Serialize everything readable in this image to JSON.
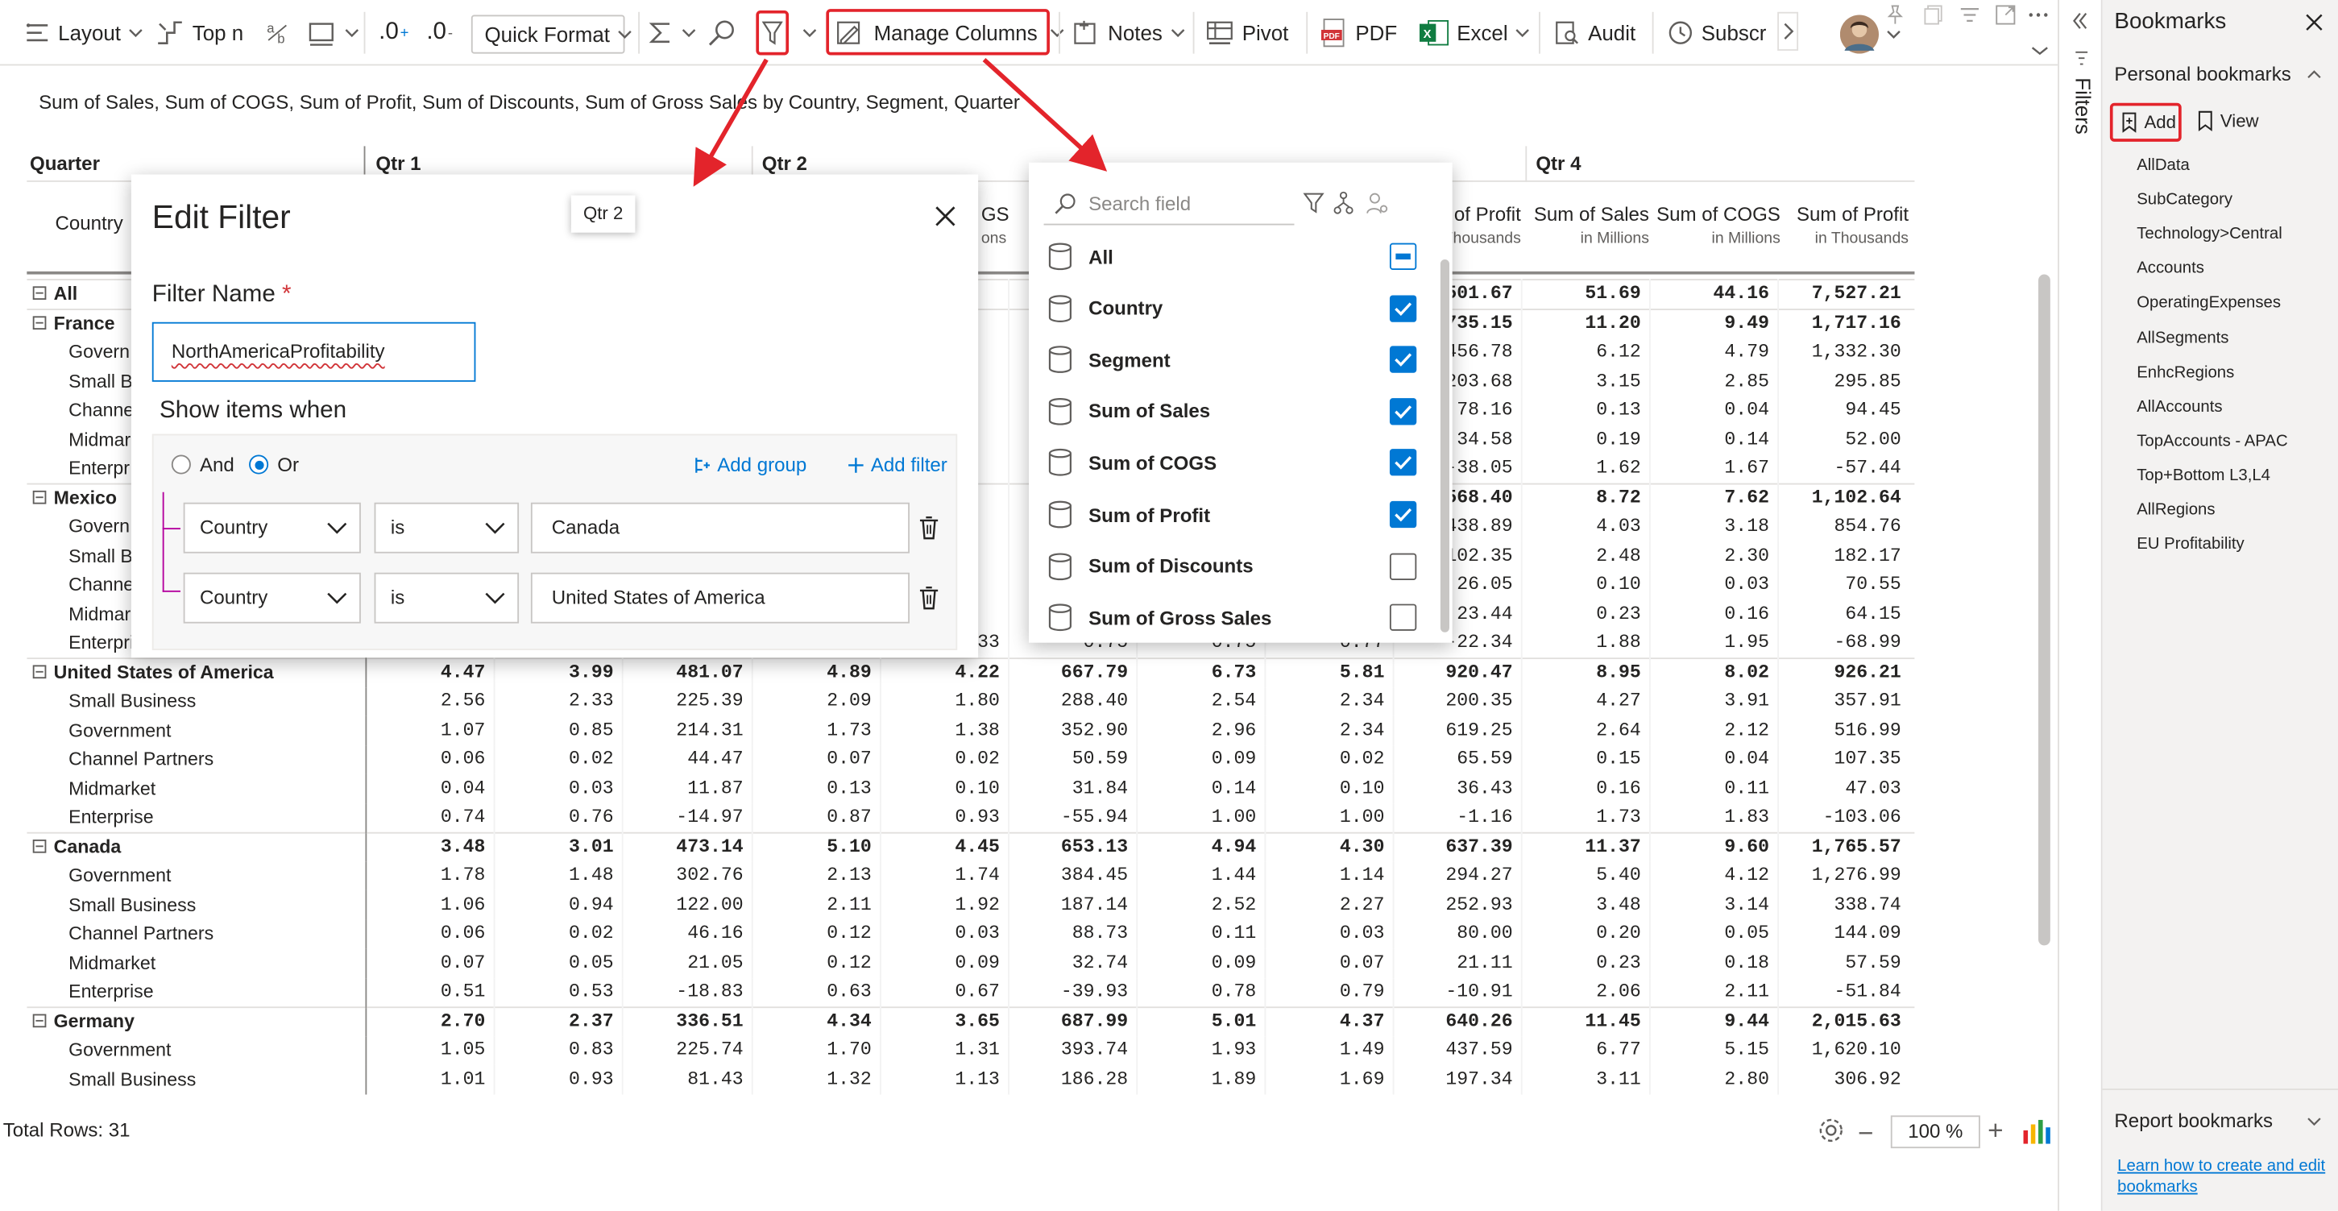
{
  "toolbar": {
    "layout": "Layout",
    "topn": "Top n",
    "decimal_inc": ".0",
    "decimal_dec": ".0",
    "quick_format": "Quick Format",
    "manage_columns": "Manage Columns",
    "notes": "Notes",
    "pivot": "Pivot",
    "pdf": "PDF",
    "excel": "Excel",
    "audit": "Audit",
    "subscr": "Subscr"
  },
  "subtitle": "Sum of Sales, Sum of COGS, Sum of Profit, Sum of Discounts, Sum of Gross Sales by Country, Segment, Quarter",
  "table": {
    "quarter_label": "Quarter",
    "country_label": "Country",
    "quarters": [
      "Qtr 1",
      "Qtr 2",
      "Qtr 4"
    ],
    "col_headers": [
      {
        "main": "of Profit",
        "sub": "Thousands"
      },
      {
        "main": "Sum of Sales",
        "sub": "in Millions"
      },
      {
        "main": "Sum of COGS",
        "sub": "in Millions"
      },
      {
        "main": "Sum of Profit",
        "sub": "in Thousands"
      }
    ],
    "partial_header": "GS",
    "partial_sub": "ons",
    "rows": [
      {
        "label": "All",
        "group": true,
        "v": [
          "",
          "",
          "",
          "46",
          "",
          "",
          "",
          "",
          "501.67",
          "51.69",
          "44.16",
          "7,527.21"
        ]
      },
      {
        "label": "France",
        "group": true,
        "v": [
          "",
          "",
          "",
          "38",
          "",
          "",
          "",
          "",
          "735.15",
          "11.20",
          "9.49",
          "1,717.16"
        ]
      },
      {
        "label": "Govern",
        "v": [
          "",
          "",
          "",
          "48",
          "",
          "",
          "",
          "",
          "456.78",
          "6.12",
          "4.79",
          "1,332.30"
        ]
      },
      {
        "label": "Small B",
        "v": [
          "",
          "",
          "",
          "90",
          "",
          "",
          "",
          "",
          "203.68",
          "3.15",
          "2.85",
          "295.85"
        ]
      },
      {
        "label": "Channe",
        "v": [
          "",
          "",
          "",
          "02",
          "",
          "",
          "",
          "",
          "78.16",
          "0.13",
          "0.04",
          "94.45"
        ]
      },
      {
        "label": "Midmar",
        "v": [
          "",
          "",
          "",
          "11",
          "",
          "",
          "",
          "",
          "34.58",
          "0.19",
          "0.14",
          "52.00"
        ]
      },
      {
        "label": "Enterpr",
        "v": [
          "",
          "",
          "",
          "87",
          "",
          "",
          "",
          "",
          "-38.05",
          "1.62",
          "1.67",
          "-57.44"
        ]
      },
      {
        "label": "Mexico",
        "group": true,
        "v": [
          "",
          "",
          "",
          "76",
          "",
          "",
          "",
          "",
          "568.40",
          "8.72",
          "7.62",
          "1,102.64"
        ]
      },
      {
        "label": "Govern",
        "v": [
          "",
          "",
          "",
          "55",
          "",
          "",
          "",
          "",
          "438.89",
          "4.03",
          "3.18",
          "854.76"
        ]
      },
      {
        "label": "Small B",
        "v": [
          "",
          "",
          "",
          "78",
          "",
          "",
          "",
          "",
          "102.35",
          "2.48",
          "2.30",
          "182.17"
        ]
      },
      {
        "label": "Channe",
        "v": [
          "",
          "",
          "",
          "17",
          "",
          "",
          "",
          "",
          "26.05",
          "0.10",
          "0.03",
          "70.55"
        ]
      },
      {
        "label": "Midmar",
        "v": [
          "",
          "",
          "",
          "08",
          "",
          "",
          "",
          "",
          "23.44",
          "0.23",
          "0.16",
          "64.15"
        ]
      },
      {
        "label": "Enterprise",
        "v": [
          "0.36",
          "0.39",
          "-30.11",
          "0.33",
          "0.33",
          "0.75",
          "0.75",
          "0.77",
          "-22.34",
          "1.88",
          "1.95",
          "-68.99"
        ]
      },
      {
        "label": "United States of America",
        "group": true,
        "v": [
          "4.47",
          "3.99",
          "481.07",
          "4.89",
          "4.22",
          "667.79",
          "6.73",
          "5.81",
          "920.47",
          "8.95",
          "8.02",
          "926.21"
        ]
      },
      {
        "label": "Small Business",
        "v": [
          "2.56",
          "2.33",
          "225.39",
          "2.09",
          "1.80",
          "288.40",
          "2.54",
          "2.34",
          "200.35",
          "4.27",
          "3.91",
          "357.91"
        ]
      },
      {
        "label": "Government",
        "v": [
          "1.07",
          "0.85",
          "214.31",
          "1.73",
          "1.38",
          "352.90",
          "2.96",
          "2.34",
          "619.25",
          "2.64",
          "2.12",
          "516.99"
        ]
      },
      {
        "label": "Channel Partners",
        "v": [
          "0.06",
          "0.02",
          "44.47",
          "0.07",
          "0.02",
          "50.59",
          "0.09",
          "0.02",
          "65.59",
          "0.15",
          "0.04",
          "107.35"
        ]
      },
      {
        "label": "Midmarket",
        "v": [
          "0.04",
          "0.03",
          "11.87",
          "0.13",
          "0.10",
          "31.84",
          "0.14",
          "0.10",
          "36.43",
          "0.16",
          "0.11",
          "47.03"
        ]
      },
      {
        "label": "Enterprise",
        "v": [
          "0.74",
          "0.76",
          "-14.97",
          "0.87",
          "0.93",
          "-55.94",
          "1.00",
          "1.00",
          "-1.16",
          "1.73",
          "1.83",
          "-103.06"
        ]
      },
      {
        "label": "Canada",
        "group": true,
        "v": [
          "3.48",
          "3.01",
          "473.14",
          "5.10",
          "4.45",
          "653.13",
          "4.94",
          "4.30",
          "637.39",
          "11.37",
          "9.60",
          "1,765.57"
        ]
      },
      {
        "label": "Government",
        "v": [
          "1.78",
          "1.48",
          "302.76",
          "2.13",
          "1.74",
          "384.45",
          "1.44",
          "1.14",
          "294.27",
          "5.40",
          "4.12",
          "1,276.99"
        ]
      },
      {
        "label": "Small Business",
        "v": [
          "1.06",
          "0.94",
          "122.00",
          "2.11",
          "1.92",
          "187.14",
          "2.52",
          "2.27",
          "252.93",
          "3.48",
          "3.14",
          "338.74"
        ]
      },
      {
        "label": "Channel Partners",
        "v": [
          "0.06",
          "0.02",
          "46.16",
          "0.12",
          "0.03",
          "88.73",
          "0.11",
          "0.03",
          "80.00",
          "0.20",
          "0.05",
          "144.09"
        ]
      },
      {
        "label": "Midmarket",
        "v": [
          "0.07",
          "0.05",
          "21.05",
          "0.12",
          "0.09",
          "32.74",
          "0.09",
          "0.07",
          "21.11",
          "0.23",
          "0.18",
          "57.59"
        ]
      },
      {
        "label": "Enterprise",
        "v": [
          "0.51",
          "0.53",
          "-18.83",
          "0.63",
          "0.67",
          "-39.93",
          "0.78",
          "0.79",
          "-10.91",
          "2.06",
          "2.11",
          "-51.84"
        ]
      },
      {
        "label": "Germany",
        "group": true,
        "v": [
          "2.70",
          "2.37",
          "336.51",
          "4.34",
          "3.65",
          "687.99",
          "5.01",
          "4.37",
          "640.26",
          "11.45",
          "9.44",
          "2,015.63"
        ]
      },
      {
        "label": "Government",
        "v": [
          "1.05",
          "0.83",
          "225.74",
          "1.70",
          "1.31",
          "393.74",
          "1.93",
          "1.49",
          "437.59",
          "6.77",
          "5.15",
          "1,620.10"
        ]
      },
      {
        "label": "Small Business",
        "v": [
          "1.01",
          "0.93",
          "81.43",
          "1.32",
          "1.13",
          "186.28",
          "1.89",
          "1.69",
          "197.34",
          "3.11",
          "2.80",
          "306.92"
        ]
      }
    ]
  },
  "status": {
    "total_rows": "Total Rows: 31",
    "zoom": "100 %"
  },
  "edit_filter": {
    "title": "Edit Filter",
    "name_label": "Filter Name",
    "required_mark": "*",
    "name_value": "NorthAmericaProfitability",
    "show_items": "Show items when",
    "and_label": "And",
    "or_label": "Or",
    "add_group": "Add group",
    "add_filter": "Add filter",
    "conditions": [
      {
        "field": "Country",
        "op": "is",
        "value": "Canada"
      },
      {
        "field": "Country",
        "op": "is",
        "value": "United States of America"
      }
    ]
  },
  "tooltip": "Qtr 2",
  "manage_columns": {
    "search_placeholder": "Search field",
    "fields": [
      {
        "label": "All",
        "state": "indeterminate"
      },
      {
        "label": "Country",
        "state": "checked"
      },
      {
        "label": "Segment",
        "state": "checked"
      },
      {
        "label": "Sum of Sales",
        "state": "checked"
      },
      {
        "label": "Sum of COGS",
        "state": "checked"
      },
      {
        "label": "Sum of Profit",
        "state": "checked"
      },
      {
        "label": "Sum of Discounts",
        "state": "unchecked"
      },
      {
        "label": "Sum of Gross Sales",
        "state": "unchecked"
      }
    ]
  },
  "filters_pane": {
    "label": "Filters"
  },
  "bookmarks": {
    "title": "Bookmarks",
    "personal": "Personal bookmarks",
    "add": "Add",
    "view": "View",
    "items": [
      "AllData",
      "SubCategory",
      "Technology>Central",
      "Accounts",
      "OperatingExpenses",
      "AllSegments",
      "EnhcRegions",
      "AllAccounts",
      "TopAccounts - APAC",
      "Top+Bottom L3,L4",
      "AllRegions",
      "EU Profitability"
    ],
    "report": "Report bookmarks",
    "learn": "Learn how to create and edit bookmarks"
  },
  "colors": {
    "accent": "#0078d4",
    "highlight": "#e3242b",
    "required": "#d13438"
  }
}
